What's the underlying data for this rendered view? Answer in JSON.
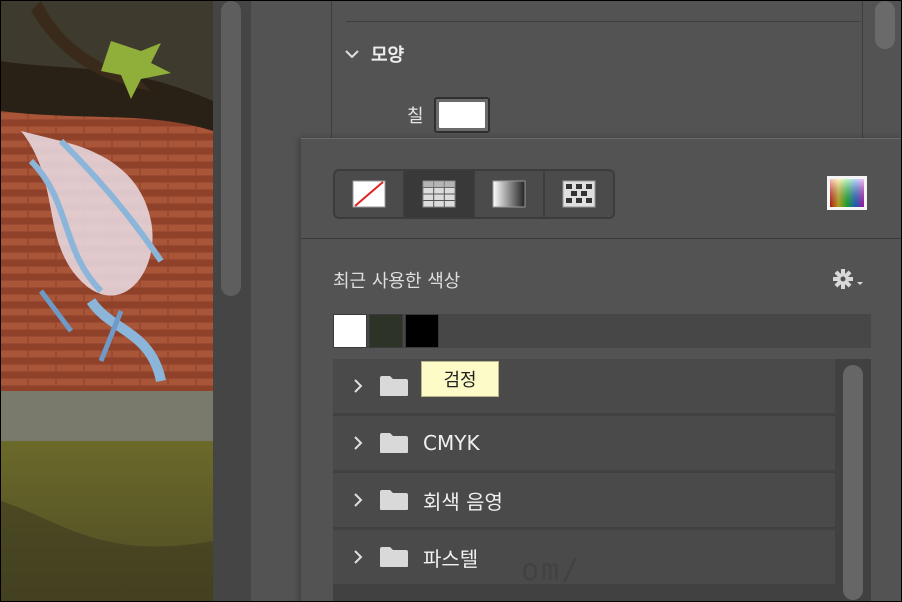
{
  "properties": {
    "section_title": "모양",
    "fill_label": "칠",
    "fill_color": "#ffffff"
  },
  "color_popup": {
    "type_buttons": [
      {
        "name": "none-swatch",
        "active": false
      },
      {
        "name": "solid-swatch",
        "active": true
      },
      {
        "name": "gradient-swatch",
        "active": false
      },
      {
        "name": "pattern-swatch",
        "active": false
      }
    ],
    "recent_title": "최근 사용한 색상",
    "recent_colors": [
      "#ffffff",
      "#2d3326",
      "#000000"
    ],
    "tooltip": "검정",
    "folders": [
      {
        "label": ""
      },
      {
        "label": "CMYK"
      },
      {
        "label": "회색 음영"
      },
      {
        "label": "파스텔"
      }
    ]
  },
  "watermark": "om/"
}
